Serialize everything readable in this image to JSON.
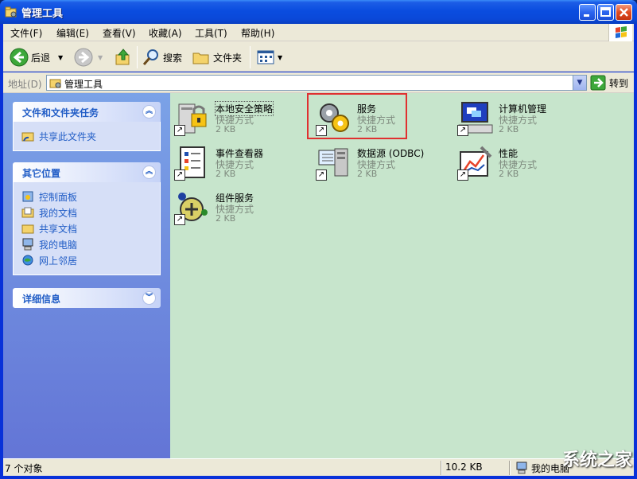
{
  "window": {
    "title": "管理工具"
  },
  "menu": [
    "文件(F)",
    "编辑(E)",
    "查看(V)",
    "收藏(A)",
    "工具(T)",
    "帮助(H)"
  ],
  "toolbar": {
    "back": "后退",
    "search": "搜索",
    "folders": "文件夹"
  },
  "address": {
    "label": "地址(D)",
    "value": "管理工具",
    "go": "转到"
  },
  "taskpane": {
    "file_tasks": {
      "title": "文件和文件夹任务",
      "items": [
        "共享此文件夹"
      ]
    },
    "other_places": {
      "title": "其它位置",
      "items": [
        "控制面板",
        "我的文档",
        "共享文档",
        "我的电脑",
        "网上邻居"
      ]
    },
    "details": {
      "title": "详细信息"
    }
  },
  "files": [
    {
      "name": "本地安全策略",
      "type": "快捷方式",
      "size": "2 KB",
      "icon": "security-policy-icon"
    },
    {
      "name": "服务",
      "type": "快捷方式",
      "size": "2 KB",
      "icon": "services-gears-icon"
    },
    {
      "name": "计算机管理",
      "type": "快捷方式",
      "size": "2 KB",
      "icon": "computer-management-icon"
    },
    {
      "name": "事件查看器",
      "type": "快捷方式",
      "size": "2 KB",
      "icon": "event-viewer-icon"
    },
    {
      "name": "数据源 (ODBC)",
      "type": "快捷方式",
      "size": "2 KB",
      "icon": "odbc-datasource-icon"
    },
    {
      "name": "性能",
      "type": "快捷方式",
      "size": "2 KB",
      "icon": "performance-icon"
    },
    {
      "name": "组件服务",
      "type": "快捷方式",
      "size": "2 KB",
      "icon": "component-services-icon"
    }
  ],
  "status": {
    "objects": "7 个对象",
    "size": "10.2 KB",
    "location": "我的电脑"
  },
  "watermark": "系统之家",
  "colors": {
    "titlebar": "#0a4ddf",
    "taskpane": "#6375d6",
    "fileview_bg": "#c7e5cc",
    "highlight": "#e03030",
    "link": "#215dc6"
  }
}
